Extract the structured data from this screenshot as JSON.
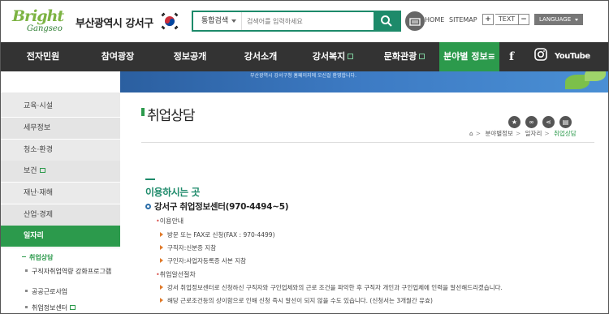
{
  "header": {
    "logo_main": "Bright",
    "logo_sub": "Gangseo",
    "site_title": "부산광역시 강서구",
    "search": {
      "category": "통합검색",
      "placeholder": "검색어를 입력하세요"
    },
    "links": {
      "home": "HOME",
      "sitemap": "SITEMAP"
    },
    "text_size": {
      "plus": "+",
      "label": "TEXT",
      "minus": "−"
    },
    "language": "LANGUAGE"
  },
  "nav": {
    "items": [
      "전자민원",
      "참여광장",
      "정보공개",
      "강서소개",
      "강서복지",
      "문화관광",
      "분야별 정보≡"
    ],
    "social": {
      "youtube": "YouTube"
    }
  },
  "banner": {
    "text": "부산광역시 강서구청 홈페이지에 오신걸 환영합니다."
  },
  "sidebar": {
    "items": [
      "교육·시설",
      "세무정보",
      "청소·환경",
      "보건",
      "재난·재해",
      "산업·경제",
      "일자리"
    ],
    "sub_items": [
      "취업상담",
      "구직자취업역량 강화프로그램",
      "공공근로사업",
      "취업정보센터"
    ]
  },
  "content": {
    "page_title": "취업상담",
    "breadcrumb": [
      "분야별정보",
      "일자리",
      "취업상담"
    ],
    "section_title": "이용하시는 곳",
    "center_name": "강서구 취업정보센터(970-4494~5)",
    "group1_label": "이용안내",
    "group1_items": [
      "방문 또는 FAX로 신청(FAX : 970-4499)",
      "구직자:신분증 지참",
      "구인자:사업자등록증 사본 지참"
    ],
    "group2_label": "취업알선절차",
    "group2_items": [
      "강서 취업정보센터로 신청하신 구직자와 구인업체와의 근로 조건을 파악한 후 구직자 개인과 구인업체에 인력을 알선해드리겠습니다.",
      "해당 근로조건등의 상이함으로 인해 신청 즉시 알선이 되지 않을 수도 있습니다. (신청서는 3개월간 유효)"
    ]
  }
}
